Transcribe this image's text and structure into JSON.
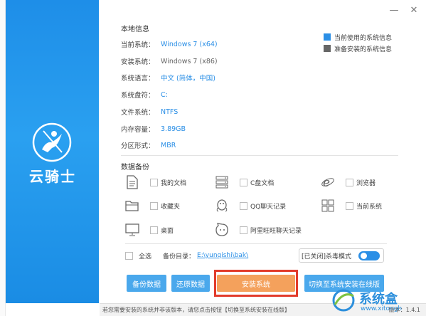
{
  "app": {
    "logo_text": "云骑士",
    "window_controls": {
      "minimize": "—",
      "close": "✕"
    }
  },
  "local_info": {
    "title": "本地信息",
    "rows": [
      {
        "label": "当前系统：",
        "value": "Windows 7 (x64)",
        "style": "blue"
      },
      {
        "label": "安装系统：",
        "value": "Windows 7 (x86)",
        "style": "gray"
      },
      {
        "label": "系统语言：",
        "value": "中文 (简体，中国)",
        "style": "blue"
      },
      {
        "label": "系统盘符：",
        "value": "C:",
        "style": "blue"
      },
      {
        "label": "文件系统：",
        "value": "NTFS",
        "style": "blue"
      },
      {
        "label": "内存容量：",
        "value": "3.89GB",
        "style": "blue"
      },
      {
        "label": "分区形式：",
        "value": "MBR",
        "style": "blue"
      }
    ]
  },
  "legend": {
    "items": [
      {
        "label": "当前使用的系统信息",
        "color": "#2b8fe6"
      },
      {
        "label": "准备安装的系统信息",
        "color": "#666666"
      }
    ]
  },
  "backup": {
    "title": "数据备份",
    "items": [
      {
        "label": "我的文档",
        "icon": "document-icon"
      },
      {
        "label": "C盘文档",
        "icon": "server-icon"
      },
      {
        "label": "浏览器",
        "icon": "ie-browser-icon"
      },
      {
        "label": "收藏夹",
        "icon": "folder-icon"
      },
      {
        "label": "QQ聊天记录",
        "icon": "qq-icon"
      },
      {
        "label": "当前系统",
        "icon": "windows-icon"
      },
      {
        "label": "桌面",
        "icon": "monitor-icon"
      },
      {
        "label": "阿里旺旺聊天记录",
        "icon": "aliwangwang-icon"
      }
    ],
    "select_all": "全选",
    "dir_label": "备份目录：",
    "dir_path": "E:\\yunqishi\\bak\\",
    "antivirus_label": "[已关闭]杀毒模式"
  },
  "buttons": {
    "backup": "备份数据",
    "restore": "还原数据",
    "install": "安装系统",
    "switch": "切换至系统安装在线版"
  },
  "status": {
    "text": "若您需要安装的系统并非该版本，请您点击按钮【切换至系统安装在线版】",
    "version": "版本：1.4.1"
  },
  "watermark": {
    "brand": "系统盒",
    "site": "www.xitongh"
  }
}
